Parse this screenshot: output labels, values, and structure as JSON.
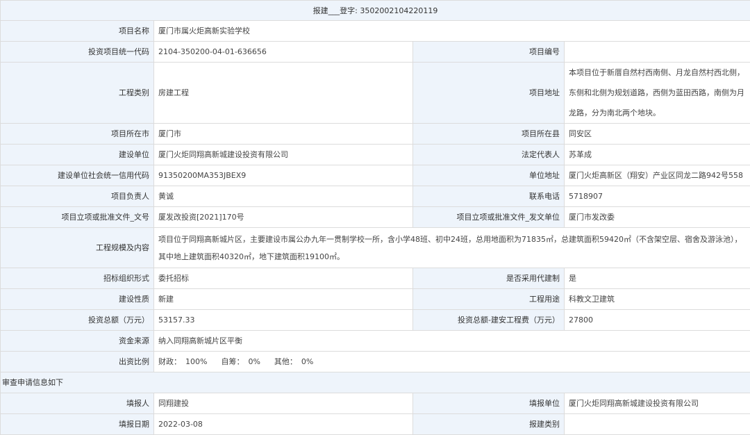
{
  "header": {
    "prefix": "报建",
    "blank": "___",
    "text": "登字: 3502002104220119"
  },
  "rows": {
    "project_name": {
      "label": "项目名称",
      "value": "厦门市属火炬高新实验学校"
    },
    "invest_code": {
      "label": "投资项目统一代码",
      "value": "2104-350200-04-01-636656"
    },
    "project_no": {
      "label": "项目编号",
      "value": ""
    },
    "eng_type": {
      "label": "工程类别",
      "value": "房建工程"
    },
    "address": {
      "label": "项目地址",
      "value": "本项目位于新厝自然村西南侧、月龙自然村西北侧，东侧和北侧为规划道路，西侧为蓝田西路，南侧为月龙路，分为南北两个地块。"
    },
    "city": {
      "label": "项目所在市",
      "value": "厦门市"
    },
    "county": {
      "label": "项目所在县",
      "value": "同安区"
    },
    "builder": {
      "label": "建设单位",
      "value": "厦门火炬同翔高新城建设投资有限公司"
    },
    "legal_rep": {
      "label": "法定代表人",
      "value": "苏革成"
    },
    "credit_code": {
      "label": "建设单位社会统一信用代码",
      "value": "91350200MA353JBEX9"
    },
    "unit_address": {
      "label": "单位地址",
      "value": "厦门火炬高新区（翔安）产业区同龙二路942号558"
    },
    "manager": {
      "label": "项目负责人",
      "value": "黄诚"
    },
    "phone": {
      "label": "联系电话",
      "value": "5718907"
    },
    "approval_no": {
      "label": "项目立项或批准文件_文号",
      "value": "厦发改投资[2021]170号"
    },
    "approval_unit": {
      "label": "项目立项或批准文件_发文单位",
      "value": "厦门市发改委"
    },
    "scale": {
      "label": "工程规模及内容",
      "value": "项目位于同翔高新城片区，主要建设市属公办九年一贯制学校一所，含小学48班、初中24班，总用地面积为71835㎡，总建筑面积59420㎡（不含架空层、宿舍及游泳池），其中地上建筑面积40320㎡，地下建筑面积19100㎡。"
    },
    "bid_form": {
      "label": "招标组织形式",
      "value": "委托招标"
    },
    "agent_system": {
      "label": "是否采用代建制",
      "value": "是"
    },
    "nature": {
      "label": "建设性质",
      "value": "新建"
    },
    "usage": {
      "label": "工程用途",
      "value": "科教文卫建筑"
    },
    "total_invest": {
      "label": "投资总额（万元）",
      "value": "53157.33"
    },
    "construct_cost": {
      "label": "投资总额-建安工程费（万元）",
      "value": "27800"
    },
    "fund_source": {
      "label": "资金来源",
      "value": "纳入同翔高新城片区平衡"
    },
    "fund_ratio": {
      "label": "出资比例",
      "fiscal_k": "财政：",
      "fiscal_v": "100%",
      "self_k": "自筹：",
      "self_v": "0%",
      "other_k": "其他：",
      "other_v": "0%"
    }
  },
  "section": {
    "title": "审查申请信息如下"
  },
  "review": {
    "filler": {
      "label": "填报人",
      "value": "同翔建投"
    },
    "filler_unit": {
      "label": "填报单位",
      "value": "厦门火炬同翔高新城建设投资有限公司"
    },
    "fill_date": {
      "label": "填报日期",
      "value": "2022-03-08"
    },
    "report_type": {
      "label": "报建类别",
      "value": ""
    }
  }
}
